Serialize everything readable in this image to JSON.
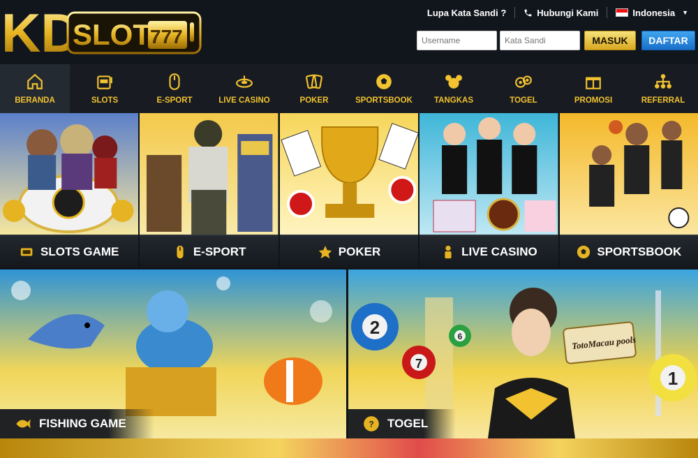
{
  "brand": {
    "logo_text": "KD",
    "logo_sub": "SLOTS",
    "logo_num": "777"
  },
  "top_links": [
    {
      "label": "Lupa Kata Sandi ?"
    },
    {
      "label": "Hubungi Kami",
      "icon": "phone-icon"
    },
    {
      "label": "Indonesia",
      "icon": "flag-indonesia-icon"
    }
  ],
  "login": {
    "username_placeholder": "Username",
    "password_placeholder": "Kata Sandi",
    "masuk_label": "MASUK",
    "daftar_label": "DAFTAR"
  },
  "nav": [
    {
      "label": "BERANDA",
      "icon": "home-icon"
    },
    {
      "label": "SLOTS",
      "icon": "slot-machine-icon"
    },
    {
      "label": "E-SPORT",
      "icon": "gaming-mouse-icon"
    },
    {
      "label": "LIVE CASINO",
      "icon": "roulette-icon"
    },
    {
      "label": "POKER",
      "icon": "cards-icon"
    },
    {
      "label": "SPORTSBOOK",
      "icon": "soccer-ball-icon"
    },
    {
      "label": "TANGKAS",
      "icon": "mouse-ears-icon"
    },
    {
      "label": "TOGEL",
      "icon": "lottery-balls-icon"
    },
    {
      "label": "PROMOSI",
      "icon": "gift-icon"
    },
    {
      "label": "REFERRAL",
      "icon": "network-icon"
    }
  ],
  "cards": [
    {
      "label": "SLOTS GAME",
      "icon": "slot-machine-icon"
    },
    {
      "label": "E-SPORT",
      "icon": "gaming-mouse-icon"
    },
    {
      "label": "POKER",
      "icon": "poker-chip-icon"
    },
    {
      "label": "LIVE CASINO",
      "icon": "dealer-icon"
    },
    {
      "label": "SPORTSBOOK",
      "icon": "soccer-ball-icon"
    }
  ],
  "banners": [
    {
      "label": "FISHING GAME",
      "icon": "fish-icon"
    },
    {
      "label": "TOGEL",
      "icon": "lottery-ball-icon",
      "ball_numbers": [
        "2",
        "6",
        "7",
        "1"
      ],
      "brand_text": "TotoMacau pools"
    }
  ],
  "colors": {
    "gold": "#f2c230",
    "header_bg": "#11161d",
    "nav_bg": "#181c22",
    "daftar_blue": "#1a6fc9"
  }
}
